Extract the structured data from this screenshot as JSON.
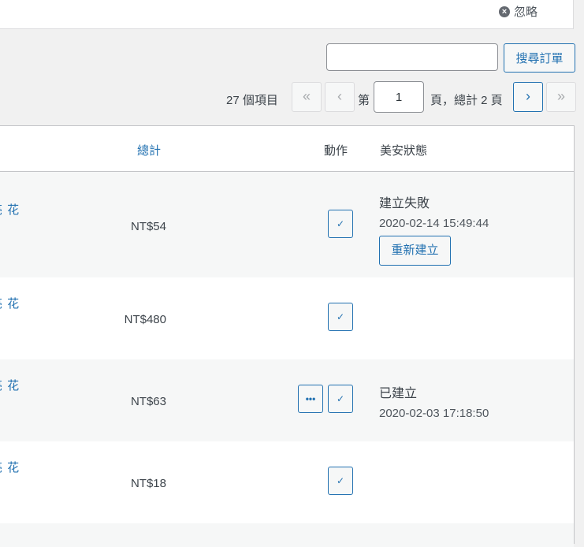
{
  "notice": {
    "dismiss_icon": "dismiss-circle-icon",
    "dismiss_label": "忽略"
  },
  "search": {
    "value": "",
    "placeholder": "",
    "button_label": "搜尋訂單"
  },
  "pagination": {
    "items_count": "27 個項目",
    "first": "«",
    "prev": "‹",
    "page_prefix": "第",
    "current_page": "1",
    "page_suffix": "頁，總計 2 頁",
    "next": "›",
    "last": "»"
  },
  "table": {
    "headers": {
      "total": "總計",
      "action": "動作",
      "status": "美安狀態"
    },
    "rows": [
      {
        "customer": "亮 花",
        "total": "NT$54",
        "actions": [
          "complete"
        ],
        "status": "建立失敗",
        "time": "2020-02-14 15:49:44",
        "rebuild_label": "重新建立"
      },
      {
        "customer": "亮 花",
        "total": "NT$480",
        "actions": [
          "complete"
        ],
        "status": "",
        "time": ""
      },
      {
        "customer": "亮 花",
        "total": "NT$63",
        "actions": [
          "more",
          "complete"
        ],
        "status": "已建立",
        "time": "2020-02-03 17:18:50"
      },
      {
        "customer": "亮 花",
        "total": "NT$18",
        "actions": [
          "complete"
        ],
        "status": "",
        "time": ""
      }
    ],
    "action_icons": {
      "more": "•••",
      "complete": "✓"
    }
  }
}
